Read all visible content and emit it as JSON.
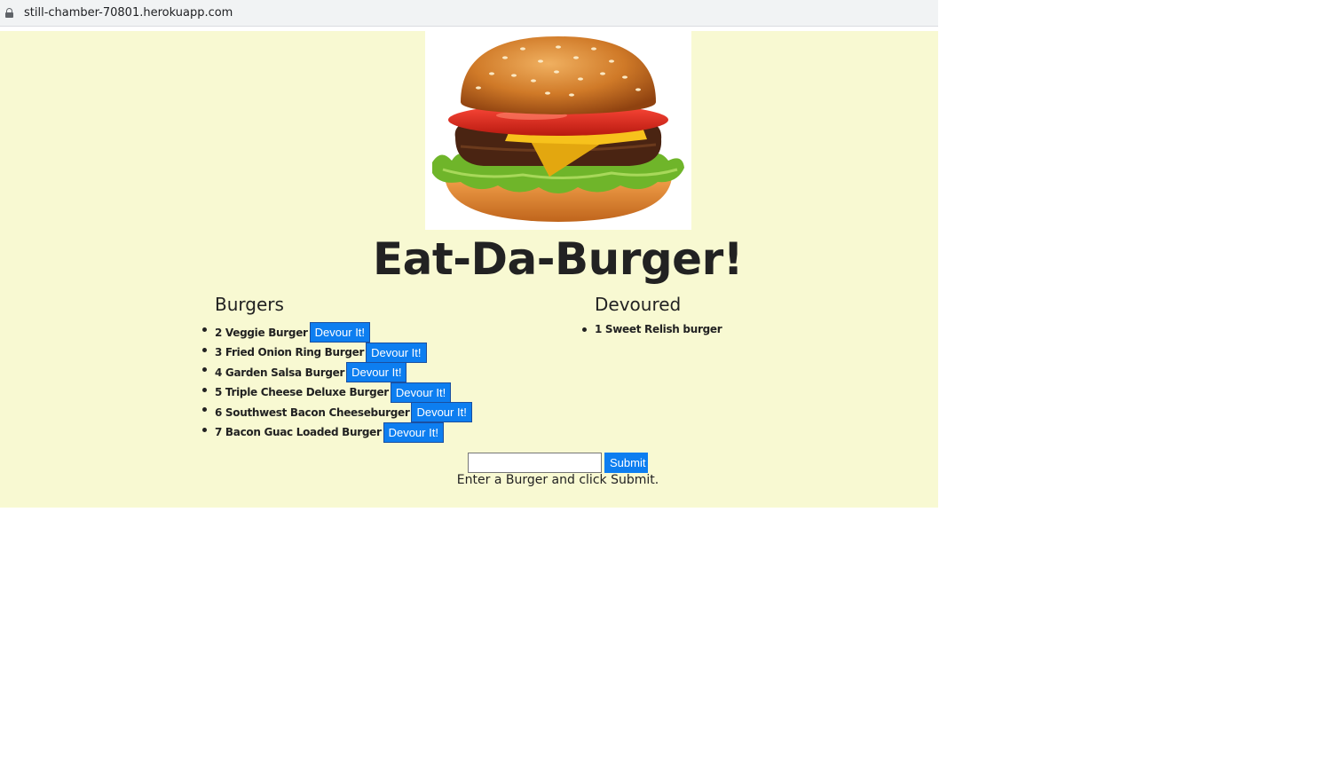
{
  "browser": {
    "url": "still-chamber-70801.herokuapp.com"
  },
  "page": {
    "title": "Eat-Da-Burger!",
    "background": "#f8f9d2",
    "accent": "#0d7ef0"
  },
  "burgers": {
    "heading": "Burgers",
    "button_label": "Devour It!",
    "items": [
      {
        "label": "2 Veggie Burger"
      },
      {
        "label": "3 Fried Onion Ring Burger"
      },
      {
        "label": "4 Garden Salsa Burger"
      },
      {
        "label": "5 Triple Cheese Deluxe Burger"
      },
      {
        "label": "6 Southwest Bacon Cheeseburger"
      },
      {
        "label": "7 Bacon Guac Loaded Burger"
      }
    ]
  },
  "devoured": {
    "heading": "Devoured",
    "items": [
      {
        "label": "1 Sweet Relish burger"
      }
    ]
  },
  "form": {
    "input_value": "",
    "submit_label": "Submit",
    "hint": "Enter a Burger and click Submit."
  }
}
